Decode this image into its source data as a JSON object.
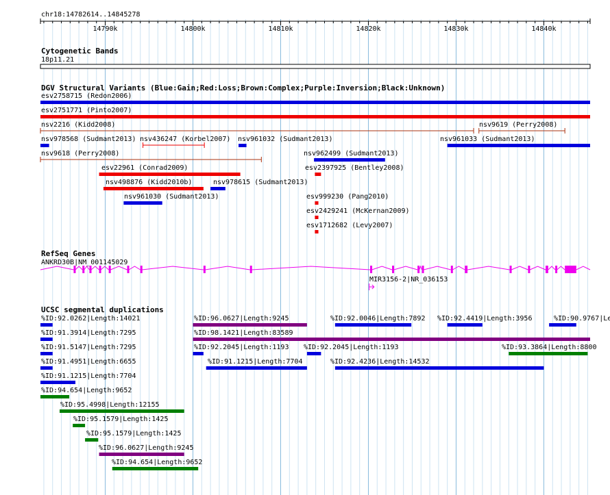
{
  "region": {
    "label": "chr18:14782614..14845278",
    "start": 14782614,
    "end": 14845278,
    "ticks": [
      "14790k",
      "14800k",
      "14810k",
      "14820k",
      "14830k",
      "14840k"
    ]
  },
  "tracks": {
    "cytoband": {
      "title": "Cytogenetic Bands",
      "band": "18p11.21"
    },
    "dgv": {
      "title": "DGV Structural Variants (Blue:Gain;Red:Loss;Brown:Complex;Purple:Inversion;Black:Unknown)",
      "colors": {
        "gain": "#0000dd",
        "loss": "#ee0000",
        "complex": "#aa3311"
      },
      "features": [
        {
          "label": "esv2758715 (Redon2006)",
          "start": 14782614,
          "end": 14845278,
          "type": "gain",
          "style": "bar"
        },
        {
          "label": "esv2751771 (Pinto2007)",
          "start": 14782614,
          "end": 14845278,
          "type": "loss",
          "style": "bar"
        },
        {
          "label": "nsv2216 (Kidd2008)",
          "start": 14782614,
          "end": 14832000,
          "type": "complex",
          "style": "line"
        },
        {
          "label": "nsv9619 (Perry2008)",
          "start": 14832600,
          "end": 14842400,
          "type": "complex",
          "style": "line"
        },
        {
          "label": "nsv978568 (Sudmant2013)",
          "start": 14782614,
          "end": 14783600,
          "type": "gain",
          "style": "bar"
        },
        {
          "label": "nsv436247 (Korbel2007)",
          "start": 14794300,
          "end": 14801300,
          "type": "loss",
          "style": "line"
        },
        {
          "label": "nsv961032 (Sudmant2013)",
          "start": 14805200,
          "end": 14806100,
          "type": "gain",
          "style": "bar"
        },
        {
          "label": "nsv961033 (Sudmant2013)",
          "start": 14829000,
          "end": 14845278,
          "type": "gain",
          "style": "bar"
        },
        {
          "label": "nsv9618 (Perry2008)",
          "start": 14782614,
          "end": 14807800,
          "type": "complex",
          "style": "line"
        },
        {
          "label": "nsv962499 (Sudmant2013)",
          "start": 14813800,
          "end": 14821900,
          "type": "gain",
          "style": "bar"
        },
        {
          "label": "esv22961 (Conrad2009)",
          "start": 14789300,
          "end": 14805400,
          "type": "loss",
          "style": "bar"
        },
        {
          "label": "esv2397925 (Bentley2008)",
          "start": 14813900,
          "end": 14814600,
          "type": "loss",
          "style": "bar"
        },
        {
          "label": "nsv498876 (Kidd2010b)",
          "start": 14789800,
          "end": 14801200,
          "type": "loss",
          "style": "bar"
        },
        {
          "label": "nsv978615 (Sudmant2013)",
          "start": 14802000,
          "end": 14803700,
          "type": "gain",
          "style": "bar"
        },
        {
          "label": "nsv961030 (Sudmant2013)",
          "start": 14792100,
          "end": 14796500,
          "type": "gain",
          "style": "bar"
        },
        {
          "label": "esv999230 (Pang2010)",
          "start": 14813900,
          "end": 14814300,
          "type": "loss",
          "style": "bar"
        },
        {
          "label": "esv2429241 (McKernan2009)",
          "start": 14813900,
          "end": 14814300,
          "type": "loss",
          "style": "bar"
        },
        {
          "label": "esv1712682 (Levy2007)",
          "start": 14813900,
          "end": 14814300,
          "type": "loss",
          "style": "bar"
        }
      ]
    },
    "refseq": {
      "title": "RefSeq Genes",
      "color": "#ee00ee",
      "genes": [
        {
          "label": "ANKRD30B|NM_001145029",
          "start": 14782614,
          "end": 14845278,
          "exons": [
            [
              14786400,
              14786600
            ],
            [
              14787400,
              14787600
            ],
            [
              14788200,
              14788400
            ],
            [
              14789300,
              14789500
            ],
            [
              14790400,
              14790600
            ],
            [
              14792500,
              14792700
            ],
            [
              14794000,
              14794200
            ],
            [
              14801200,
              14801400
            ],
            [
              14806500,
              14806700
            ],
            [
              14820200,
              14820400
            ],
            [
              14822700,
              14822900
            ],
            [
              14825600,
              14825800
            ],
            [
              14826100,
              14826300
            ],
            [
              14829400,
              14829600
            ],
            [
              14831000,
              14831300
            ],
            [
              14836100,
              14836300
            ],
            [
              14838200,
              14838400
            ],
            [
              14840200,
              14840500
            ],
            [
              14841300,
              14841500
            ],
            [
              14842400,
              14843700
            ]
          ]
        },
        {
          "label": "MIR3156-2|NR_036153",
          "start": 14820100,
          "end": 14820300,
          "strand": "+"
        }
      ]
    },
    "segdup": {
      "title": "UCSC segmental duplications",
      "colors": {
        "blue": "#0000dd",
        "purple": "#800080",
        "green": "#007f00"
      },
      "features": [
        {
          "label": "%ID:92.0262|Length:14021",
          "start": 14782614,
          "end": 14784000,
          "color": "blue"
        },
        {
          "label": "%ID:96.0627|Length:9245",
          "start": 14800000,
          "end": 14813000,
          "color": "purple"
        },
        {
          "label": "%ID:92.0046|Length:7892",
          "start": 14816200,
          "end": 14824900,
          "color": "blue"
        },
        {
          "label": "%ID:92.4419|Length:3956",
          "start": 14829000,
          "end": 14833000,
          "color": "blue"
        },
        {
          "label": "%ID:90.9767|Le",
          "start": 14840600,
          "end": 14843700,
          "color": "blue"
        },
        {
          "label": "%ID:91.3914|Length:7295",
          "start": 14782614,
          "end": 14784000,
          "color": "blue"
        },
        {
          "label": "%ID:98.1421|Length:83589",
          "start": 14800000,
          "end": 14845278,
          "color": "purple"
        },
        {
          "label": "%ID:91.5147|Length:7295",
          "start": 14782614,
          "end": 14784000,
          "color": "blue"
        },
        {
          "label": "%ID:92.2045|Length:1193",
          "start": 14800000,
          "end": 14801200,
          "color": "blue"
        },
        {
          "label": "%ID:92.2045|Length:1193",
          "start": 14813000,
          "end": 14814600,
          "color": "blue"
        },
        {
          "label": "%ID:93.3864|Length:8800",
          "start": 14836000,
          "end": 14845000,
          "color": "green"
        },
        {
          "label": "%ID:91.4951|Length:6655",
          "start": 14782614,
          "end": 14784000,
          "color": "blue"
        },
        {
          "label": "%ID:91.1215|Length:7704",
          "start": 14801500,
          "end": 14813000,
          "color": "blue"
        },
        {
          "label": "%ID:92.4236|Length:14532",
          "start": 14816200,
          "end": 14840000,
          "color": "blue"
        },
        {
          "label": "%ID:91.1215|Length:7704",
          "start": 14782614,
          "end": 14786600,
          "color": "blue"
        },
        {
          "label": "%ID:94.654|Length:9652",
          "start": 14782614,
          "end": 14785900,
          "color": "green"
        },
        {
          "label": "%ID:95.4998|Length:12155",
          "start": 14784800,
          "end": 14799000,
          "color": "green"
        },
        {
          "label": "%ID:95.1579|Length:1425",
          "start": 14786300,
          "end": 14787700,
          "color": "green"
        },
        {
          "label": "%ID:95.1579|Length:1425",
          "start": 14787700,
          "end": 14789200,
          "color": "green"
        },
        {
          "label": "%ID:96.0627|Length:9245",
          "start": 14789300,
          "end": 14799000,
          "color": "purple"
        },
        {
          "label": "%ID:94.654|Length:9652",
          "start": 14790800,
          "end": 14800600,
          "color": "green"
        }
      ]
    }
  }
}
